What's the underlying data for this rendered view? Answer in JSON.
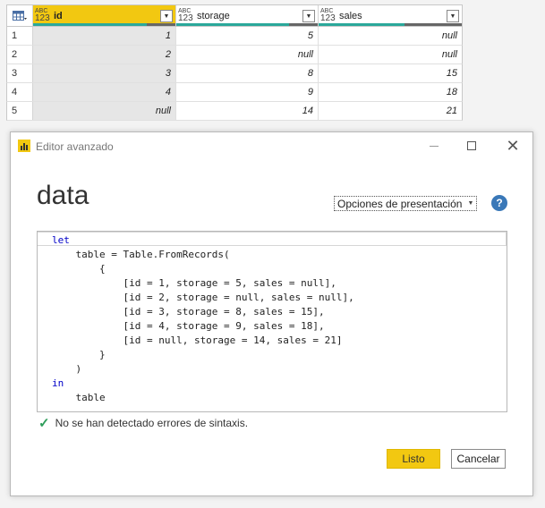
{
  "grid": {
    "columns": [
      {
        "type_top": "ABC",
        "type_bottom": "123",
        "name": "id"
      },
      {
        "type_top": "ABC",
        "type_bottom": "123",
        "name": "storage"
      },
      {
        "type_top": "ABC",
        "type_bottom": "123",
        "name": "sales"
      }
    ],
    "rows": [
      {
        "n": "1",
        "id": "1",
        "storage": "5",
        "sales": "null"
      },
      {
        "n": "2",
        "id": "2",
        "storage": "null",
        "sales": "null"
      },
      {
        "n": "3",
        "id": "3",
        "storage": "8",
        "sales": "15"
      },
      {
        "n": "4",
        "id": "4",
        "storage": "9",
        "sales": "18"
      },
      {
        "n": "5",
        "id": "null",
        "storage": "14",
        "sales": "21"
      }
    ],
    "quality": [
      {
        "valid_fraction": 0.8
      },
      {
        "valid_fraction": 0.8
      },
      {
        "valid_fraction": 0.6
      }
    ],
    "colors": {
      "selected_header": "#f2c811",
      "valid": "#2aa89a",
      "null": "#666666"
    }
  },
  "dialog": {
    "title": "Editor avanzado",
    "query_name": "data",
    "view_options_label": "Opciones de presentación",
    "help_label": "?",
    "code_lines": [
      "let",
      "    table = Table.FromRecords(",
      "        {",
      "            [id = 1, storage = 5, sales = null],",
      "            [id = 2, storage = null, sales = null],",
      "            [id = 3, storage = 8, sales = 15],",
      "            [id = 4, storage = 9, sales = 18],",
      "            [id = null, storage = 14, sales = 21]",
      "        }",
      "    )",
      "in",
      "    table"
    ],
    "status_text": "No se han detectado errores de sintaxis.",
    "ok_label": "Listo",
    "cancel_label": "Cancelar",
    "icons": {
      "app": "power-bi-icon",
      "status": "check-icon",
      "minimize": "minimize-icon",
      "maximize": "maximize-icon",
      "close": "close-icon"
    }
  }
}
